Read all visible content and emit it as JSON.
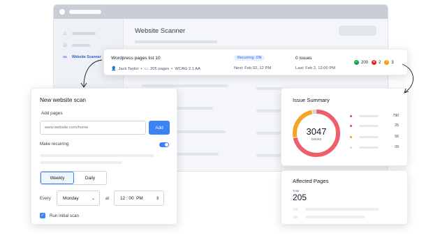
{
  "app": {
    "title": "Website Scanner",
    "sidebar_active_label": "Website Scanner"
  },
  "scan_row": {
    "title": "Wordpress pages list 10",
    "user": "Jack Taylor",
    "pages": "205 pages",
    "standard": "WCAG 2.1 AA",
    "recurring_badge": "Recurring: ON",
    "next": "Next: Feb 02, 12 PM",
    "issues": "0 issues",
    "last": "Last: Feb 2, 12:00 PM",
    "counts": [
      {
        "value": "200",
        "color": "#16a34a",
        "icon": "check-icon",
        "glyph": "✓"
      },
      {
        "value": "2",
        "color": "#dc2626",
        "icon": "x-icon",
        "glyph": "✕"
      },
      {
        "value": "3",
        "color": "#f59e0b",
        "icon": "warning-icon",
        "glyph": "!"
      }
    ]
  },
  "new_scan": {
    "title": "New website scan",
    "add_pages_label": "Add pages",
    "url_placeholder": "www.website.com/home",
    "add_button": "Add",
    "recurring_label": "Make recurring",
    "recurring_on": true,
    "frequency_options": [
      "Weekly",
      "Daily"
    ],
    "frequency_selected": "Weekly",
    "every_label": "Every",
    "day": "Monday",
    "at_label": "at",
    "time": "12 : 00  PM",
    "initial_scan_label": "Run initial scan",
    "initial_scan_checked": true
  },
  "issue_summary": {
    "title": "Issue Summary",
    "total": "3047",
    "total_label": "Issues",
    "legend": [
      {
        "value": "790",
        "color": "#ef4444"
      },
      {
        "value": "25",
        "color": "#ef4444"
      },
      {
        "value": "56",
        "color": "#f59e0b"
      },
      {
        "value": "09",
        "color": "#d1d5db"
      }
    ],
    "ring": [
      {
        "share": 0.72,
        "color": "#ef5f6b"
      },
      {
        "share": 0.25,
        "color": "#f5a524"
      },
      {
        "share": 0.03,
        "color": "#d1d5db"
      }
    ]
  },
  "affected_pages": {
    "title": "Affected Pages",
    "total_label": "Total",
    "total": "205"
  }
}
